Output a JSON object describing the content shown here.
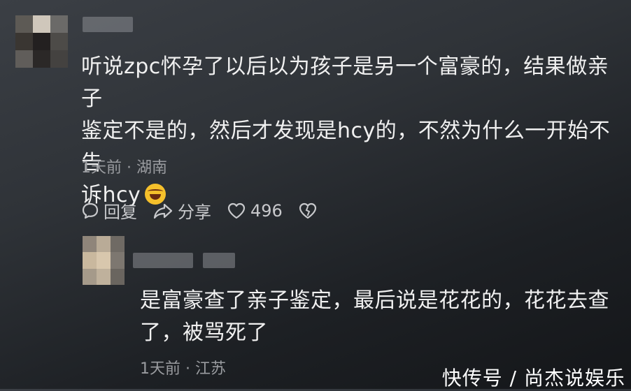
{
  "comment1": {
    "text_line1": "听说zpc怀孕了以后以为孩子是另一个富豪的，结果做亲子",
    "text_line2": "鉴定不是的，然后才发现是hcy的，不然为什么一开始不告",
    "text_line3": "诉hcy",
    "emoji": "laughing-crying-emoji",
    "time": "1天前",
    "separator": "·",
    "location": "湖南",
    "reply_label": "回复",
    "share_label": "分享",
    "like_count": "496"
  },
  "comment2": {
    "text_line1": "是富豪查了亲子鉴定，最后说是花花的，花花去查",
    "text_line2": "了，被骂死了",
    "time": "1天前",
    "separator": "·",
    "location": "江苏"
  },
  "watermark": "快传号 / 尚杰说娱乐",
  "icons": {
    "reply": "speech-bubble-icon",
    "share": "share-arrow-icon",
    "like": "heart-icon",
    "dislike": "broken-heart-icon"
  },
  "colors": {
    "text": "#f0f0f0",
    "meta": "#9a9ca0",
    "action": "#c8c9cc"
  }
}
